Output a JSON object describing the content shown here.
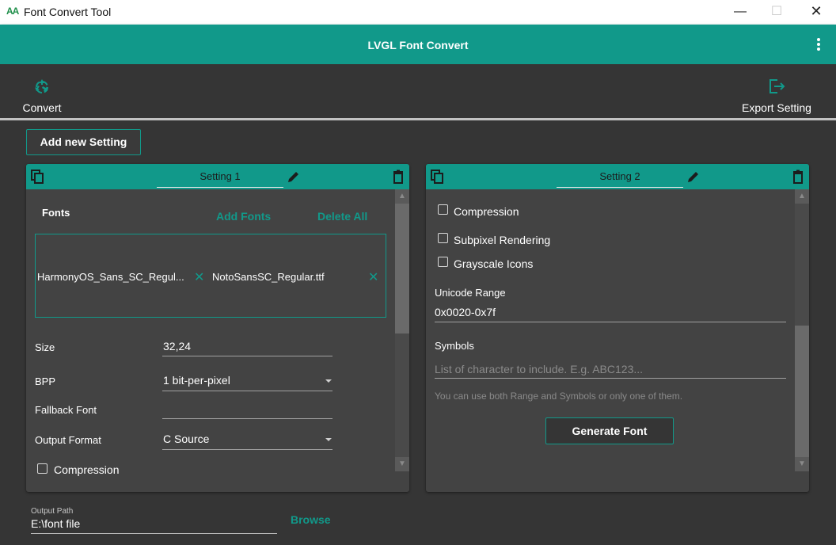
{
  "window": {
    "icon_text": "AA",
    "title": "Font Convert Tool",
    "minimize": "—",
    "maximize": "☐",
    "close": "✕"
  },
  "appbar": {
    "title": "LVGL Font Convert"
  },
  "toolbar": {
    "convert_label": "Convert",
    "export_label": "Export Setting"
  },
  "add_setting_label": "Add new Setting",
  "settings": [
    {
      "title": "Setting 1",
      "fonts_label": "Fonts",
      "add_fonts": "Add Fonts",
      "delete_all": "Delete All",
      "fonts": [
        "HarmonyOS_Sans_SC_Regul...",
        "NotoSansSC_Regular.ttf"
      ],
      "remove_icon": "✕",
      "size_label": "Size",
      "size_value": "32,24",
      "bpp_label": "BPP",
      "bpp_value": "1 bit-per-pixel",
      "fallback_label": "Fallback Font",
      "fallback_value": "",
      "output_format_label": "Output Format",
      "output_format_value": "C Source",
      "compression_label": "Compression"
    },
    {
      "title": "Setting 2",
      "compression_label": "Compression",
      "subpixel_label": "Subpixel Rendering",
      "grayscale_label": "Grayscale Icons",
      "unicode_label": "Unicode Range",
      "unicode_value": "0x0020-0x7f",
      "symbols_label": "Symbols",
      "symbols_placeholder": "List of character to include. E.g. ABC123...",
      "hint": "You can use both Range and Symbols or only one of them.",
      "generate_label": "Generate Font"
    }
  ],
  "output": {
    "label": "Output Path",
    "value": "E:\\font file",
    "browse_label": "Browse"
  },
  "colors": {
    "accent": "#11998a",
    "background": "#353535",
    "card": "#434343"
  },
  "icons": {
    "convert": "recycle-icon",
    "export": "export-icon",
    "copy": "copy-icon",
    "edit": "pencil-icon",
    "delete": "trash-icon"
  }
}
